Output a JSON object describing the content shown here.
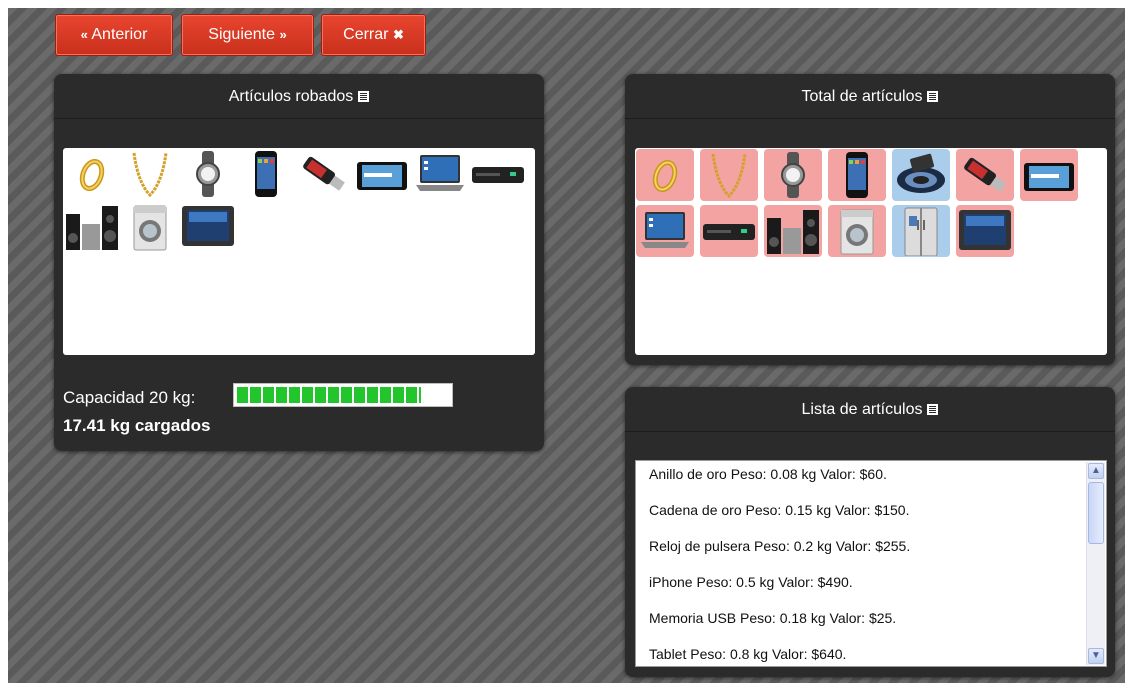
{
  "nav": {
    "prev_label": "Anterior",
    "prev_icon": "«",
    "next_label": "Siguiente",
    "next_icon": "»",
    "close_label": "Cerrar",
    "close_icon": "✖"
  },
  "stolen_panel": {
    "title": "Artículos robados",
    "items": [
      "anillo",
      "cadena",
      "reloj",
      "iphone",
      "usb",
      "tablet",
      "laptop",
      "dvd",
      "estereo",
      "lavadora",
      "tv"
    ]
  },
  "capacity": {
    "label": "Capacidad 20 kg:",
    "loaded_text": "17.41 kg cargados",
    "fill_fraction": 0.87
  },
  "total_panel": {
    "title": "Total de artículos",
    "tiles": [
      {
        "item": "anillo",
        "state": "stolen"
      },
      {
        "item": "cadena",
        "state": "stolen"
      },
      {
        "item": "reloj",
        "state": "stolen"
      },
      {
        "item": "iphone",
        "state": "stolen"
      },
      {
        "item": "camara",
        "state": "available"
      },
      {
        "item": "usb",
        "state": "stolen"
      },
      {
        "item": "tablet",
        "state": "stolen"
      },
      {
        "item": "laptop",
        "state": "stolen"
      },
      {
        "item": "dvd",
        "state": "stolen"
      },
      {
        "item": "estereo",
        "state": "stolen"
      },
      {
        "item": "lavadora",
        "state": "stolen"
      },
      {
        "item": "refrigerador",
        "state": "available"
      },
      {
        "item": "tv",
        "state": "stolen"
      }
    ]
  },
  "list_panel": {
    "title": "Lista de artículos",
    "rows": [
      "Anillo de oro Peso: 0.08 kg Valor: $60.",
      "Cadena de oro Peso: 0.15 kg Valor: $150.",
      "Reloj de pulsera Peso: 0.2 kg Valor: $255.",
      "iPhone Peso: 0.5 kg Valor: $490.",
      "Memoria USB Peso: 0.18 kg Valor: $25.",
      "Tablet Peso: 0.8 kg Valor: $640."
    ]
  },
  "colors": {
    "stolen_tile": "#f3a3a2",
    "available_tile": "#a9cdeb",
    "button": "#d83a24",
    "progress": "#22c52b"
  }
}
